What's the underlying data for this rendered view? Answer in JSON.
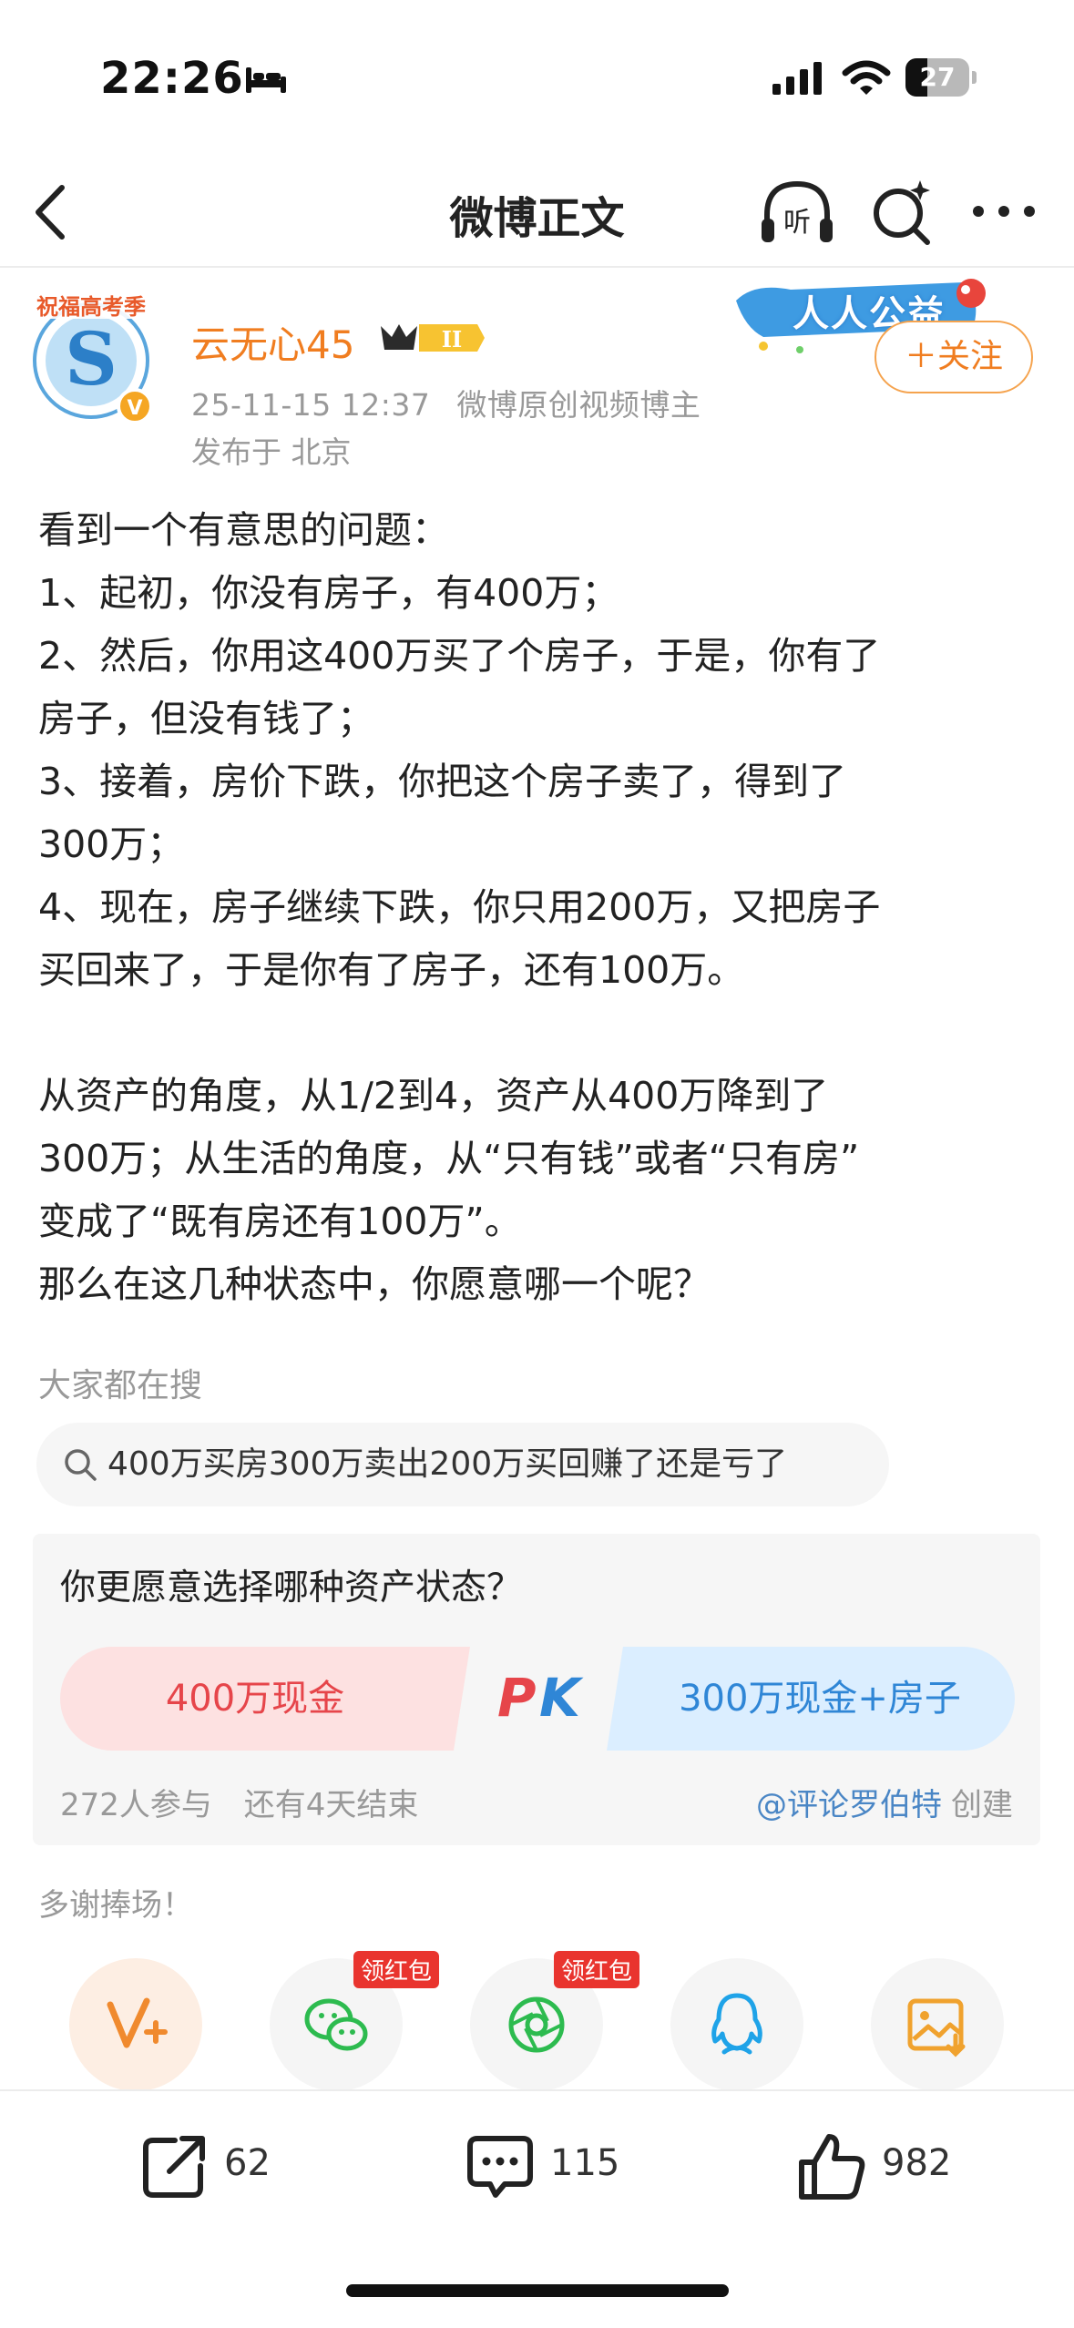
{
  "status_bar": {
    "time": "22:26",
    "battery_level": "27"
  },
  "nav": {
    "title": "微博正文"
  },
  "author": {
    "name": "云无心45",
    "level_badge": "II",
    "timestamp": "25-11-15 12:37",
    "tag": "微博原创视频博主",
    "location": "发布于 北京",
    "charity_label": "人人公益",
    "follow_label": "＋关注",
    "avatar_lettering": "祝福高考季"
  },
  "post": {
    "lines": [
      "看到一个有意思的问题：",
      "1、起初，你没有房子，有400万；",
      "2、然后，你用这400万买了个房子，于是，你有了",
      "房子，但没有钱了；",
      "3、接着，房价下跌，你把这个房子卖了，得到了",
      "300万；",
      "4、现在，房子继续下跌，你只用200万，又把房子",
      "买回来了，于是你有了房子，还有100万。",
      "",
      "从资产的角度，从1/2到4，资产从400万降到了",
      "300万；从生活的角度，从“只有钱”或者“只有房”",
      "变成了“既有房还有100万”。",
      "那么在这几种状态中，你愿意哪一个呢？"
    ]
  },
  "search": {
    "section_label": "大家都在搜",
    "query": "400万买房300万卖出200万买回赚了还是亏了"
  },
  "pk": {
    "question": "你更愿意选择哪种资产状态？",
    "left_option": "400万现金",
    "vs_label": "PK",
    "right_option": "300万现金+房子",
    "participants": "272人参与",
    "remaining": "还有4天结束",
    "creator_handle": "@评论罗伯特",
    "creator_suffix": "创建",
    "colors": {
      "left": "#e6454a",
      "right": "#2f86d6"
    }
  },
  "thanks": {
    "label": "多谢捧场！"
  },
  "share": {
    "items": [
      {
        "icon": "vplus-icon"
      },
      {
        "icon": "wechat-icon",
        "badge": "领红包"
      },
      {
        "icon": "moments-icon",
        "badge": "领红包"
      },
      {
        "icon": "qq-icon"
      },
      {
        "icon": "save-image-icon"
      }
    ]
  },
  "actions": {
    "repost_count": "62",
    "comment_count": "115",
    "like_count": "982"
  },
  "colors": {
    "accent": "#f07d20",
    "muted": "#999999",
    "link": "#4a86c5"
  }
}
